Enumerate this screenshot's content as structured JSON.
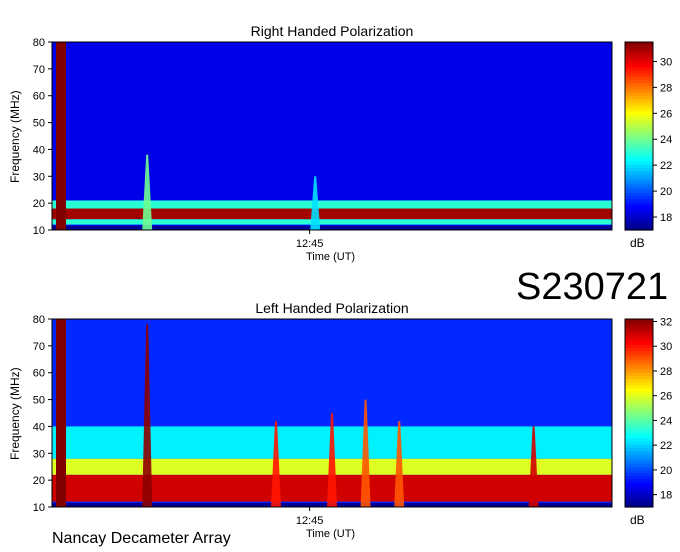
{
  "observation_id": "S230721",
  "instrument": "Nancay Decameter Array",
  "chart_data": [
    {
      "type": "heatmap",
      "title": "Right Handed Polarization",
      "xlabel": "Time (UT)",
      "ylabel": "Frequency (MHz)",
      "x_tick_labels": [
        "12:45"
      ],
      "y_ticks": [
        10,
        20,
        30,
        40,
        50,
        60,
        70,
        80
      ],
      "ylim": [
        10,
        80
      ],
      "colorbar": {
        "unit": "dB",
        "ticks": [
          18,
          20,
          22,
          24,
          26,
          28,
          30
        ],
        "range": [
          17,
          31.5
        ]
      },
      "colormap": "jet",
      "features": {
        "background_db": 18.5,
        "bands": [
          {
            "f_low": 14,
            "f_high": 18,
            "db": 31
          },
          {
            "f_low": 12,
            "f_high": 14,
            "db": 23
          },
          {
            "f_low": 18,
            "f_high": 21,
            "db": 23
          }
        ],
        "bursts": [
          {
            "t": 0.17,
            "f_top": 38,
            "db": 24
          },
          {
            "t": 0.47,
            "f_top": 30,
            "db": 22
          }
        ]
      }
    },
    {
      "type": "heatmap",
      "title": "Left Handed Polarization",
      "xlabel": "Time (UT)",
      "ylabel": "Frequency (MHz)",
      "x_tick_labels": [
        "12:45"
      ],
      "y_ticks": [
        10,
        20,
        30,
        40,
        50,
        60,
        70,
        80
      ],
      "ylim": [
        10,
        80
      ],
      "colorbar": {
        "unit": "dB",
        "ticks": [
          18,
          20,
          22,
          24,
          26,
          28,
          30,
          32
        ],
        "range": [
          17,
          32.2
        ]
      },
      "colormap": "jet",
      "features": {
        "background_db": 19.5,
        "bands": [
          {
            "f_low": 12,
            "f_high": 22,
            "db": 31
          },
          {
            "f_low": 22,
            "f_high": 28,
            "db": 26
          },
          {
            "f_low": 28,
            "f_high": 40,
            "db": 22.5
          }
        ],
        "bursts": [
          {
            "t": 0.17,
            "f_top": 78,
            "db": 32
          },
          {
            "t": 0.4,
            "f_top": 42,
            "db": 30
          },
          {
            "t": 0.5,
            "f_top": 45,
            "db": 30
          },
          {
            "t": 0.56,
            "f_top": 50,
            "db": 29
          },
          {
            "t": 0.62,
            "f_top": 42,
            "db": 29
          },
          {
            "t": 0.86,
            "f_top": 40,
            "db": 31
          }
        ]
      }
    }
  ]
}
